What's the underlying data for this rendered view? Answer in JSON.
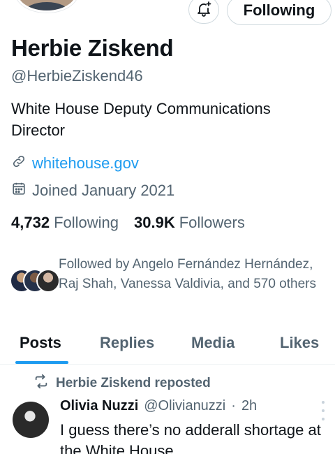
{
  "profile": {
    "name": "Herbie Ziskend",
    "handle": "@HerbieZiskend46",
    "bio": "White House Deputy Communications Director",
    "link": "whitehouse.gov",
    "joined": "Joined January 2021",
    "following_count": "4,732",
    "following_label": "Following",
    "followers_count": "30.9K",
    "followers_label": "Followers",
    "followed_by": "Followed by Angelo Fernández Hernández, Raj Shah, Vanessa Valdivia, and 570 others"
  },
  "actions": {
    "notifications_icon": "bell-plus-icon",
    "follow_state_label": "Following"
  },
  "tabs": [
    {
      "label": "Posts",
      "active": true
    },
    {
      "label": "Replies",
      "active": false
    },
    {
      "label": "Media",
      "active": false
    },
    {
      "label": "Likes",
      "active": false
    }
  ],
  "post": {
    "repost_label": "Herbie Ziskend reposted",
    "author_name": "Olivia Nuzzi",
    "author_handle": "@Olivianuzzi",
    "separator": "·",
    "time": "2h",
    "text": "I guess there’s no adderall shortage at the White House"
  },
  "colors": {
    "accent": "#1d9bf0",
    "text_primary": "#0f1419",
    "text_secondary": "#536471"
  }
}
